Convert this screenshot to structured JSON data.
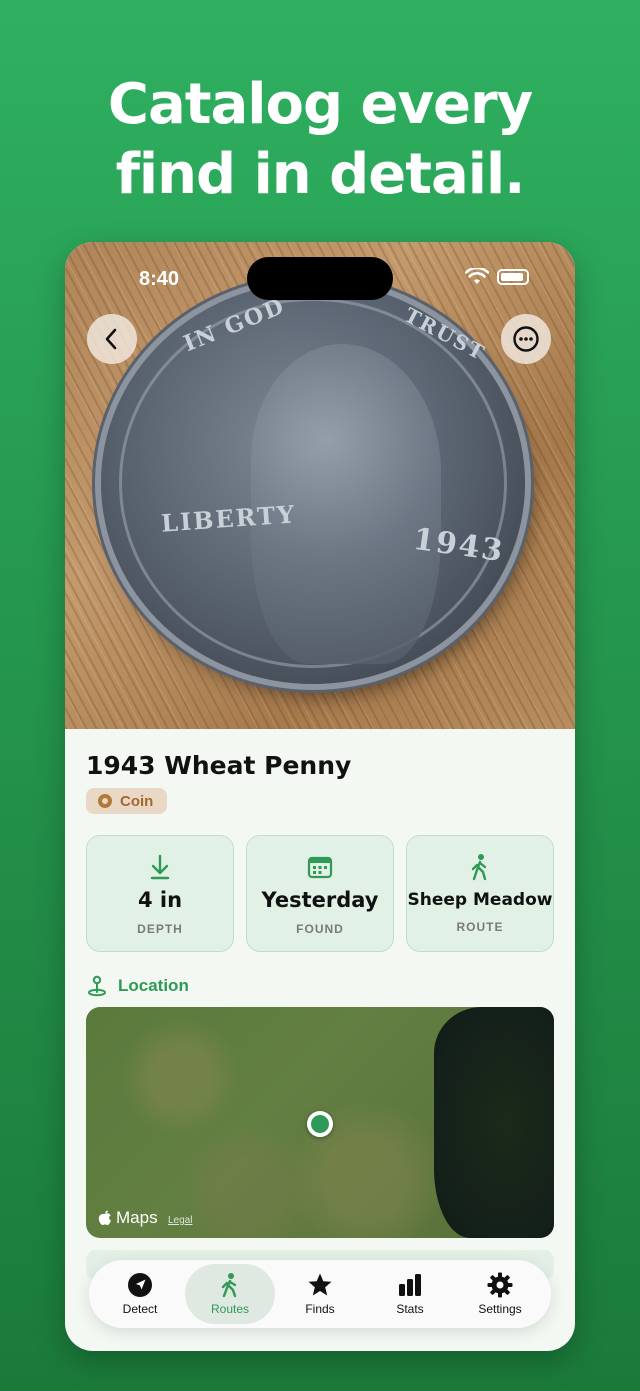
{
  "headline": {
    "line1": "Catalog every",
    "line2": "find in detail."
  },
  "status_bar": {
    "time": "8:40"
  },
  "hero": {
    "coin_liberty": "LIBERTY",
    "coin_year": "1943",
    "coin_motto": "IN GOD",
    "coin_trust": "TRUST"
  },
  "find": {
    "title": "1943 Wheat Penny",
    "category": "Coin",
    "stats": [
      {
        "value": "4 in",
        "label": "DEPTH",
        "icon": "arrow-down-icon"
      },
      {
        "value": "Yesterday",
        "label": "FOUND",
        "icon": "calendar-icon"
      },
      {
        "value": "Sheep Meadow",
        "label": "ROUTE",
        "icon": "walking-icon"
      }
    ]
  },
  "location": {
    "heading": "Location",
    "map_brand": "Maps",
    "map_legal": "Legal"
  },
  "tabs": [
    {
      "label": "Detect",
      "icon": "location-arrow-icon",
      "active": false
    },
    {
      "label": "Routes",
      "icon": "walking-icon",
      "active": true
    },
    {
      "label": "Finds",
      "icon": "star-icon",
      "active": false
    },
    {
      "label": "Stats",
      "icon": "bar-chart-icon",
      "active": false
    },
    {
      "label": "Settings",
      "icon": "gear-icon",
      "active": false
    }
  ],
  "colors": {
    "brand_green": "#2e9a55",
    "background_top": "#2fb061",
    "background_bottom": "#1b7a3a",
    "badge_bg": "#ead8c6",
    "badge_text": "#a16a2c"
  }
}
